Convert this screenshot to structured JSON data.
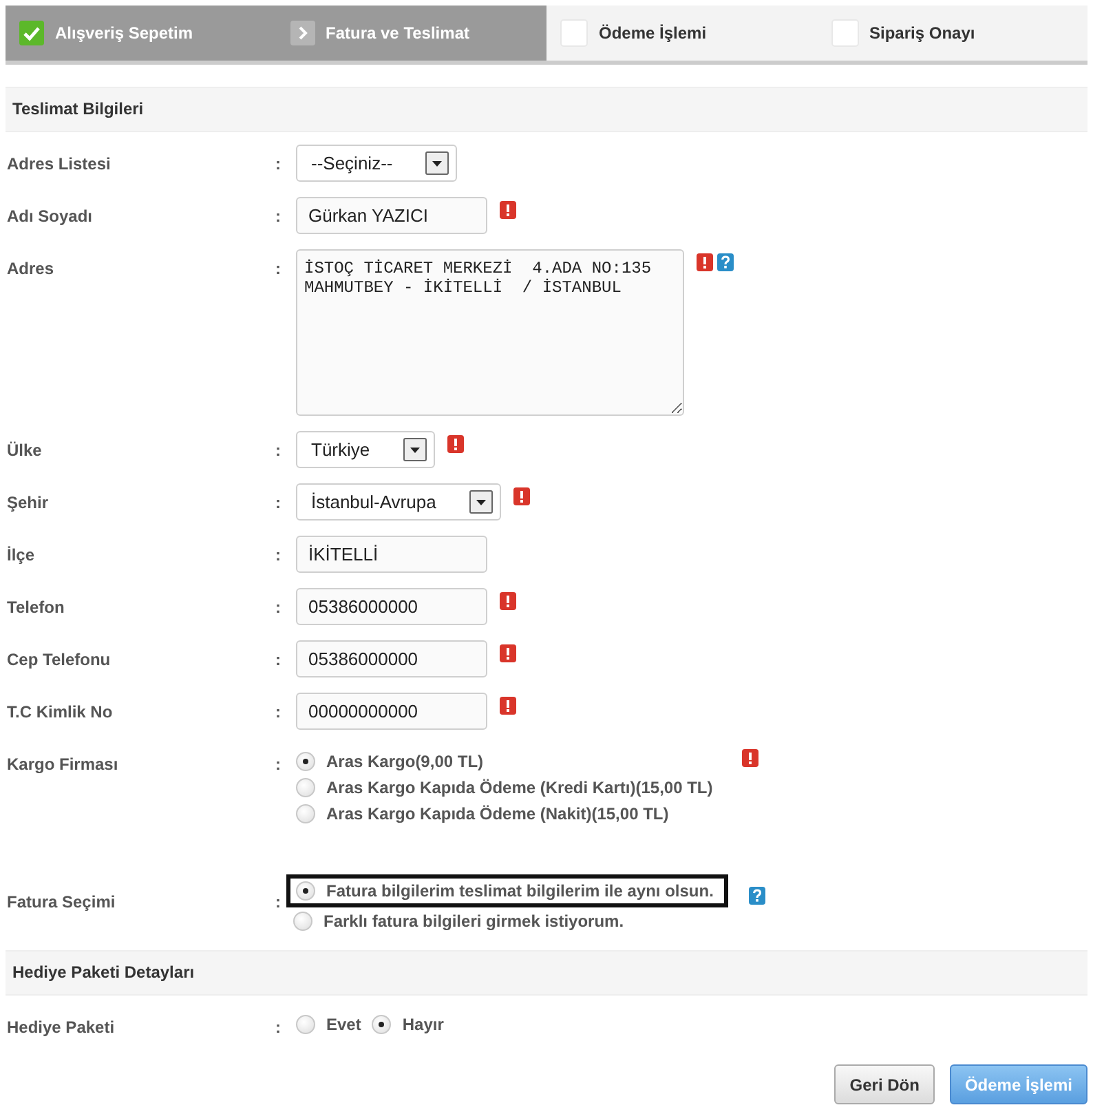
{
  "steps": [
    {
      "label": "Alışveriş Sepetim",
      "completed": true,
      "active": false
    },
    {
      "label": "Fatura ve Teslimat",
      "completed": false,
      "active": true
    },
    {
      "label": "Ödeme İşlemi",
      "completed": false,
      "active": false
    },
    {
      "label": "Sipariş Onayı",
      "completed": false,
      "active": false
    }
  ],
  "sections": [
    {
      "title": "Teslimat Bilgileri",
      "rows": [
        {
          "label": "Adres Listesi",
          "colon": ":",
          "kind": "select",
          "value": "--Seçiniz--",
          "error": false,
          "help": false
        },
        {
          "label": "Adı Soyadı",
          "colon": ":",
          "kind": "text",
          "value": "Gürkan YAZICI",
          "error": true,
          "help": false
        },
        {
          "label": "Adres",
          "colon": ":",
          "kind": "textarea",
          "value": "İSTOÇ TİCARET MERKEZİ  4.ADA NO:135\nMAHMUTBEY - İKİTELLİ  / İSTANBUL",
          "error": true,
          "help": true
        },
        {
          "label": "Ülke",
          "colon": ":",
          "kind": "select",
          "value": "Türkiye",
          "error": true,
          "help": false
        },
        {
          "label": "Şehir",
          "colon": ":",
          "kind": "select",
          "value": "İstanbul-Avrupa",
          "error": true,
          "help": false
        },
        {
          "label": "İlçe",
          "colon": ":",
          "kind": "text",
          "value": "İKİTELLİ",
          "error": false,
          "help": false
        },
        {
          "label": "Telefon",
          "colon": ":",
          "kind": "text",
          "value": "05386000000",
          "error": true,
          "help": false
        },
        {
          "label": "Cep Telefonu",
          "colon": ":",
          "kind": "text",
          "value": "05386000000",
          "error": true,
          "help": false
        },
        {
          "label": "T.C Kimlik No",
          "colon": ":",
          "kind": "text",
          "value": "00000000000",
          "error": true,
          "help": false
        },
        {
          "label": "Kargo Firması",
          "colon": ":",
          "kind": "radio",
          "inline": false,
          "highlighted": false,
          "error": true,
          "help": false,
          "options": [
            {
              "label": "Aras Kargo(9,00 TL)",
              "selected": true
            },
            {
              "label": "Aras Kargo Kapıda Ödeme (Kredi Kartı)(15,00 TL)",
              "selected": false
            },
            {
              "label": "Aras Kargo Kapıda Ödeme (Nakit)(15,00 TL)",
              "selected": false
            }
          ]
        },
        {
          "label": "Fatura Seçimi",
          "colon": ":",
          "kind": "radio",
          "inline": false,
          "highlighted": true,
          "error": false,
          "help": true,
          "options": [
            {
              "label": "Fatura bilgilerim teslimat bilgilerim ile aynı olsun.",
              "selected": true
            },
            {
              "label": "Farklı fatura bilgileri girmek istiyorum.",
              "selected": false
            }
          ]
        }
      ]
    },
    {
      "title": "Hediye Paketi Detayları",
      "rows": [
        {
          "label": "Hediye Paketi",
          "colon": ":",
          "kind": "radio",
          "inline": true,
          "highlighted": false,
          "error": false,
          "help": false,
          "options": [
            {
              "label": "Evet",
              "selected": false
            },
            {
              "label": "Hayır",
              "selected": true
            }
          ]
        }
      ]
    }
  ],
  "buttons": [
    {
      "label": "Geri Dön",
      "kind": "secondary"
    },
    {
      "label": "Ödeme İşlemi",
      "kind": "primary"
    }
  ]
}
